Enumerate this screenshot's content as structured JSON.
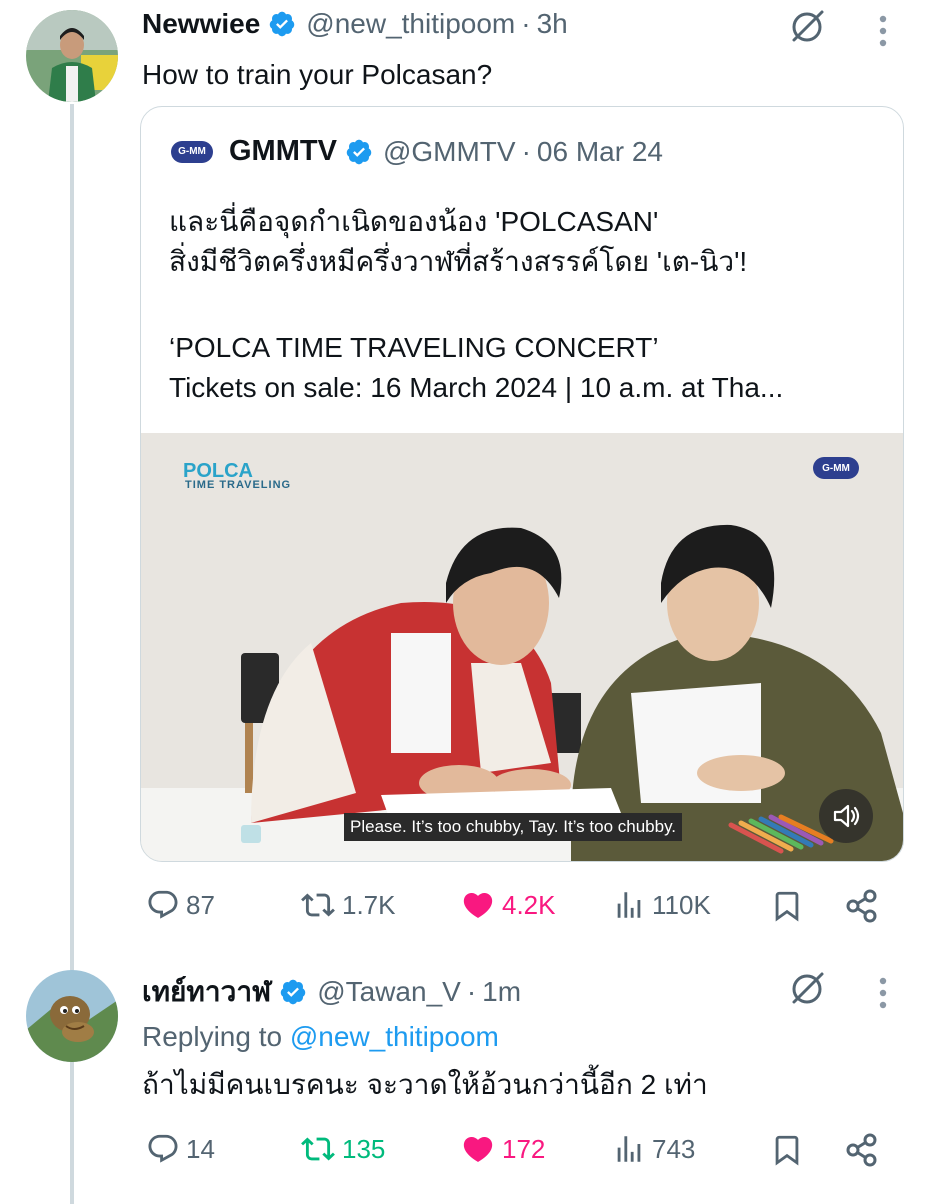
{
  "tweet1": {
    "name": "Newwiee",
    "handle": "@new_thitipoom",
    "sep": "·",
    "time": "3h",
    "text": "How to train your Polcasan?",
    "quote": {
      "logo_text": "G-MM",
      "name": "GMMTV",
      "handle": "@GMMTV",
      "sep": "·",
      "time": "06 Mar 24",
      "lines": [
        "และนี่คือจุดกำเนิดของน้อง 'POLCASAN'",
        "สิ่งมีชีวิตครึ่งหมีครึ่งวาฬที่สร้างสรรค์โดย 'เต-นิว'!",
        "‘POLCA TIME TRAVELING CONCERT’",
        "Tickets on sale: 16 March 2024 | 10 a.m. at Tha..."
      ],
      "media": {
        "logo_left": "TIME TRAVELING",
        "logo_right": "G-MM",
        "subtitle": "Please. It’s too chubby, Tay. It’s too chubby."
      }
    },
    "stats": {
      "replies": "87",
      "reposts": "1.7K",
      "likes": "4.2K",
      "views": "110K"
    }
  },
  "tweet2": {
    "name": "เทย์ทาวาฬ",
    "handle": "@Tawan_V",
    "sep": "·",
    "time": "1m",
    "replying_prefix": "Replying to",
    "replying_to": "@new_thitipoom",
    "text": "ถ้าไม่มีคนเบรคนะ จะวาดให้อ้วนกว่านี้อีก 2 เท่า",
    "stats": {
      "replies": "14",
      "reposts": "135",
      "likes": "172",
      "views": "743"
    }
  },
  "colors": {
    "accent": "#1d9bf0",
    "muted": "#536471",
    "repost_active": "#00ba7c",
    "like_active": "#f91880"
  },
  "icons": [
    "verified-icon",
    "grok-icon",
    "more-icon",
    "reply-icon",
    "repost-icon",
    "like-icon",
    "views-icon",
    "bookmark-icon",
    "share-icon",
    "mute-icon"
  ]
}
